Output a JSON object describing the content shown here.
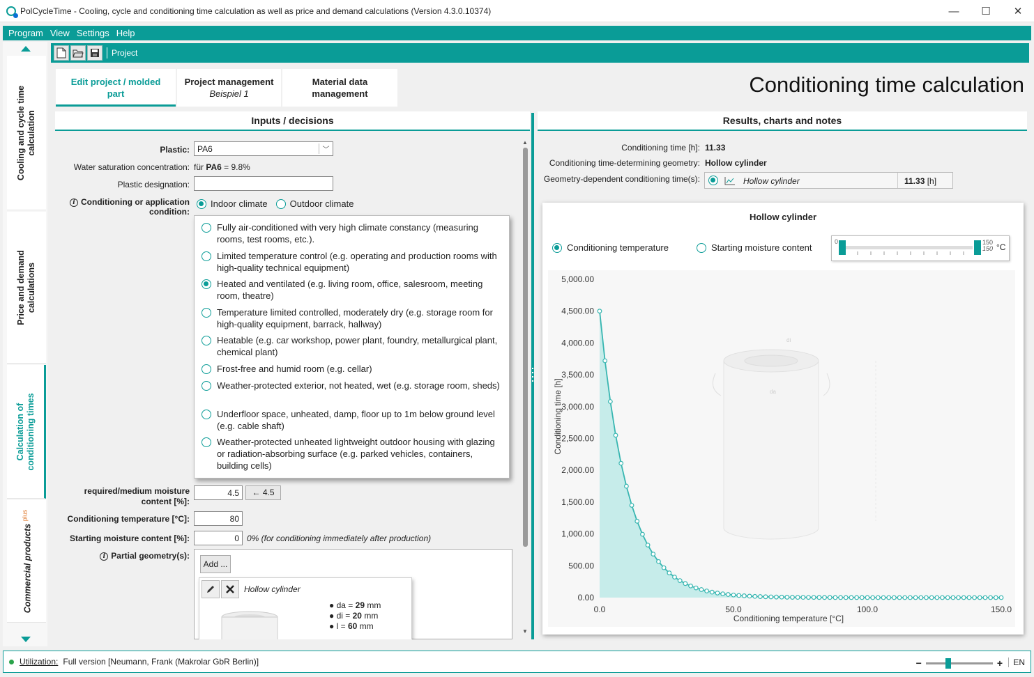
{
  "window": {
    "title": "PolCycleTime - Cooling, cycle and conditioning time calculation as well as price and demand calculations (Version 4.3.0.10374)"
  },
  "menu": {
    "items": [
      "Program",
      "View",
      "Settings",
      "Help"
    ]
  },
  "leftnav": {
    "tabs": [
      {
        "label": "Cooling and cycle time calculation"
      },
      {
        "label": "Price and demand calculations"
      },
      {
        "label": "Calculation of conditioning times"
      },
      {
        "label": "Commercial products",
        "sup": "plus"
      }
    ]
  },
  "toolbar": {
    "breadcrumb": "Project"
  },
  "toptabs": {
    "edit": "Edit project / molded part",
    "project": "Project management",
    "project_sub": "Beispiel 1",
    "material": "Material data management"
  },
  "page_title": "Conditioning time calculation",
  "inputs": {
    "header": "Inputs / decisions",
    "plastic_label": "Plastic:",
    "plastic_value": "PA6",
    "water_label": "Water saturation concentration:",
    "water_prefix": "für ",
    "water_material": "PA6",
    "water_suffix": " = 9.8%",
    "designation_label": "Plastic designation:",
    "designation_value": "",
    "condition_label": "Conditioning or application condition:",
    "indoor": "Indoor climate",
    "outdoor": "Outdoor climate",
    "climate_options": [
      "Fully air-conditioned with very high climate constancy (measuring rooms, test rooms, etc.).",
      "Limited temperature control (e.g. operating and production rooms with high-quality technical equipment)",
      "Heated and ventilated (e.g. living room, office, salesroom, meeting room, theatre)",
      "Temperature limited controlled, moderately dry (e.g. storage room for high-quality equipment, barrack, hallway)",
      "Heatable (e.g. car workshop, power plant, foundry, metallurgical plant, chemical plant)",
      "Frost-free and humid room (e.g. cellar)",
      "Weather-protected exterior, not heated, wet (e.g. storage room, sheds)",
      "Underfloor space, unheated, damp, floor up to 1m below ground level (e.g. cable shaft)",
      "Weather-protected unheated lightweight outdoor housing with glazing or radiation-absorbing surface (e.g. parked vehicles, containers, building cells)"
    ],
    "selected_option": 2,
    "moisture_label": "required/medium moisture content [%]:",
    "moisture_value": "4.5",
    "moisture_btn": "← 4.5",
    "temp_label": "Conditioning temperature [°C]:",
    "temp_value": "80",
    "start_label": "Starting moisture content [%]:",
    "start_value": "0",
    "start_note": "0% (for conditioning immediately after production)",
    "partial_label": "Partial geometry(s):",
    "add_btn": "Add ...",
    "geom_name": "Hollow cylinder",
    "dims": [
      {
        "name": "da",
        "value": "29",
        "unit": "mm"
      },
      {
        "name": "di",
        "value": "20",
        "unit": "mm"
      },
      {
        "name": "l",
        "value": "60",
        "unit": "mm"
      }
    ]
  },
  "results": {
    "header": "Results, charts and notes",
    "time_label": "Conditioning time [h]:",
    "time_value": "11.33",
    "geom_label": "Conditioning time-determining geometry:",
    "geom_value": "Hollow cylinder",
    "dep_label": "Geometry-dependent conditioning time(s):",
    "dep_name": "Hollow cylinder",
    "dep_value": "11.33",
    "dep_unit": "[h]",
    "radio_temp": "Conditioning temperature",
    "radio_moist": "Starting moisture content",
    "slider_min": "0",
    "slider_max": "150",
    "slider_max_italic": "150",
    "slider_unit": "°C",
    "figure_labels": {
      "da": "da",
      "di": "di"
    }
  },
  "chart_data": {
    "type": "area",
    "title": "Hollow cylinder",
    "xlabel": "Conditioning temperature [°C]",
    "ylabel": "Conditioning time [h]",
    "xlim": [
      0,
      150
    ],
    "ylim": [
      0,
      5000
    ],
    "xticks": [
      "0.0",
      "50.0",
      "100.0",
      "150.0"
    ],
    "yticks": [
      "0.00",
      "500.00",
      "1,000.00",
      "1,500.00",
      "2,000.00",
      "2,500.00",
      "3,000.00",
      "3,500.00",
      "4,000.00",
      "4,500.00",
      "5,000.00"
    ],
    "series": [
      {
        "color": "#38b6b1",
        "fill": "#c6ecea",
        "x": [
          0,
          2,
          4,
          6,
          8,
          10,
          12,
          14,
          16,
          18,
          20,
          22,
          24,
          26,
          28,
          30,
          32,
          34,
          36,
          38,
          40,
          42,
          44,
          46,
          48,
          50,
          52,
          54,
          56,
          58,
          60,
          62,
          64,
          66,
          68,
          70,
          72,
          74,
          76,
          78,
          80,
          82,
          84,
          86,
          88,
          90,
          92,
          94,
          96,
          98,
          100,
          102,
          104,
          106,
          108,
          110,
          112,
          114,
          116,
          118,
          120,
          122,
          124,
          126,
          128,
          130,
          132,
          134,
          136,
          138,
          140,
          142,
          144,
          146,
          148,
          150
        ],
        "y": [
          4500,
          3720,
          3080,
          2550,
          2110,
          1750,
          1450,
          1200,
          995,
          825,
          683,
          566,
          469,
          388,
          322,
          267,
          221,
          183,
          152,
          126,
          104,
          86,
          72,
          59,
          49,
          41,
          34,
          28,
          23,
          19,
          16,
          13,
          11,
          9,
          8,
          6,
          5,
          4,
          4,
          3,
          3,
          2,
          2,
          2,
          1,
          1,
          1,
          1,
          1,
          1,
          1,
          0,
          0,
          0,
          0,
          0,
          0,
          0,
          0,
          0,
          0,
          0,
          0,
          0,
          0,
          0,
          0,
          0,
          0,
          0,
          0,
          0,
          0,
          0,
          0,
          0
        ]
      }
    ]
  },
  "status": {
    "link": "Utilization:",
    "text": "Full version [Neumann, Frank (Makrolar GbR Berlin)]",
    "lang": "EN",
    "zoom_minus": "−",
    "zoom_plus": "+"
  },
  "colors": {
    "accent": "#0a9c97"
  }
}
